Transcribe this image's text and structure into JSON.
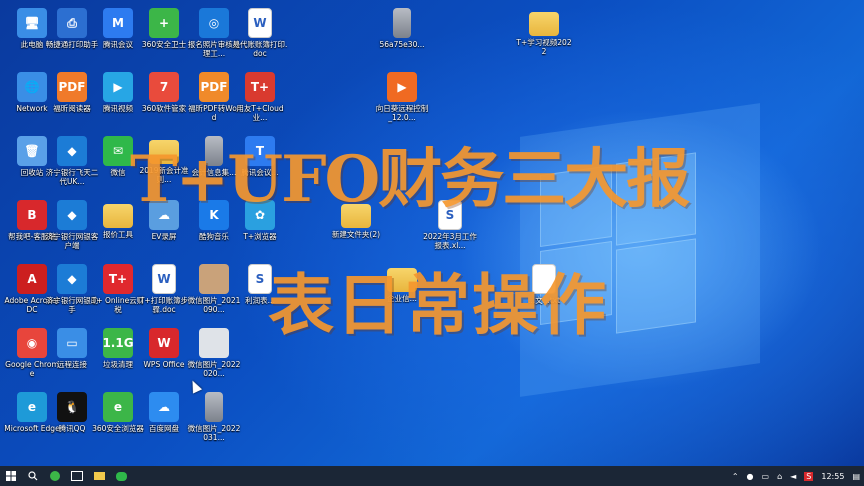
{
  "desktop": {
    "icons": [
      {
        "label": "此电脑",
        "glyph": "🖥",
        "color": "#3a8ee6"
      },
      {
        "label": "畅捷通打印助手",
        "glyph": "⎙",
        "color": "#2c6fd1"
      },
      {
        "label": "腾讯会议",
        "glyph": "M",
        "color": "#2d7bf0"
      },
      {
        "label": "360安全卫士",
        "glyph": "+",
        "color": "#3cb648"
      },
      {
        "label": "报名照片审核处理工...",
        "glyph": "◎",
        "color": "#1a78d9"
      },
      {
        "label": "易代账账簿打印.doc",
        "glyph": "W",
        "color": "#ffffff"
      },
      {
        "label": "56a75e30...",
        "glyph": "",
        "color": "#9aa0a8"
      },
      {
        "label": "T+学习视频2022",
        "glyph": "",
        "color": "#f2c94c"
      },
      {
        "label": "Network",
        "glyph": "🌐",
        "color": "#3a8ee6"
      },
      {
        "label": "福昕阅读器",
        "glyph": "PDF",
        "color": "#f07a2a"
      },
      {
        "label": "腾讯视频",
        "glyph": "▶",
        "color": "#27a6e5"
      },
      {
        "label": "360软件管家",
        "glyph": "7",
        "color": "#e94b3c"
      },
      {
        "label": "福昕PDF转Word",
        "glyph": "PDF",
        "color": "#f08a2a"
      },
      {
        "label": "用友T+Cloud业...",
        "glyph": "T+",
        "color": "#d93a2f"
      },
      {
        "label": "向日葵远程控制_12.0...",
        "glyph": "▶",
        "color": "#f06a22"
      },
      {
        "label": "回收站",
        "glyph": "🗑",
        "color": "#5aa0e8"
      },
      {
        "label": "济宁银行飞天二代UK...",
        "glyph": "◆",
        "color": "#1c7cd6"
      },
      {
        "label": "微信",
        "glyph": "✉",
        "color": "#2fb84a"
      },
      {
        "label": "2019新会计准则...",
        "glyph": "",
        "color": "#f2c94c"
      },
      {
        "label": "会计信息集...",
        "glyph": "",
        "color": "#9aa0a8"
      },
      {
        "label": "腾讯会议...",
        "glyph": "T",
        "color": "#2d7bf0"
      },
      {
        "label": "帮我吧-客服端",
        "glyph": "B",
        "color": "#d8282c"
      },
      {
        "label": "济宁银行网银客户端",
        "glyph": "◆",
        "color": "#1c7cd6"
      },
      {
        "label": "报价工具",
        "glyph": "",
        "color": "#f2c94c"
      },
      {
        "label": "EV录屏",
        "glyph": "☁",
        "color": "#5a9ee0"
      },
      {
        "label": "酷狗音乐",
        "glyph": "K",
        "color": "#1a7ae8"
      },
      {
        "label": "T+浏览器",
        "glyph": "✿",
        "color": "#2aa0e0"
      },
      {
        "label": "新建文件夹(2)",
        "glyph": "",
        "color": "#f2c94c"
      },
      {
        "label": "2022年3月工作报表.xl...",
        "glyph": "S",
        "color": "#ffffff"
      },
      {
        "label": "Adobe Acrobat DC",
        "glyph": "A",
        "color": "#cc1f1f"
      },
      {
        "label": "济宁银行网银助手",
        "glyph": "◆",
        "color": "#1c7cd6"
      },
      {
        "label": "T+ Online云财税",
        "glyph": "T+",
        "color": "#e0282e"
      },
      {
        "label": "T+打印账簿步骤.doc",
        "glyph": "W",
        "color": "#ffffff"
      },
      {
        "label": "微信图片_2021090...",
        "glyph": "",
        "color": "#c9a27a"
      },
      {
        "label": "利润表...",
        "glyph": "S",
        "color": "#ffffff"
      },
      {
        "label": "企业信...",
        "glyph": "",
        "color": "#f2c94c"
      },
      {
        "label": "...文...txt",
        "glyph": "",
        "color": "#ffffff"
      },
      {
        "label": "Google Chrome",
        "glyph": "◉",
        "color": "#e8453c"
      },
      {
        "label": "远程连接",
        "glyph": "▭",
        "color": "#3a8ee6"
      },
      {
        "label": "垃圾清理",
        "glyph": "1.1G",
        "color": "#3cb648"
      },
      {
        "label": "WPS Office",
        "glyph": "W",
        "color": "#d8282c"
      },
      {
        "label": "微信图片_2022020...",
        "glyph": "",
        "color": "#dfe3e8"
      },
      {
        "label": "Microsoft Edge",
        "glyph": "e",
        "color": "#1e9ad8"
      },
      {
        "label": "腾讯QQ",
        "glyph": "🐧",
        "color": "#111111"
      },
      {
        "label": "360安全浏览器",
        "glyph": "e",
        "color": "#3cb648"
      },
      {
        "label": "百度网盘",
        "glyph": "☁",
        "color": "#2d8cf0"
      },
      {
        "label": "微信图片_2022031...",
        "glyph": "",
        "color": "#9aa0a8"
      }
    ]
  },
  "overlay": {
    "line1": "T+UFO财务三大报",
    "line2": "表日常操作"
  },
  "taskbar": {
    "start_icon": "windows-start-icon",
    "clock": "12:55"
  }
}
